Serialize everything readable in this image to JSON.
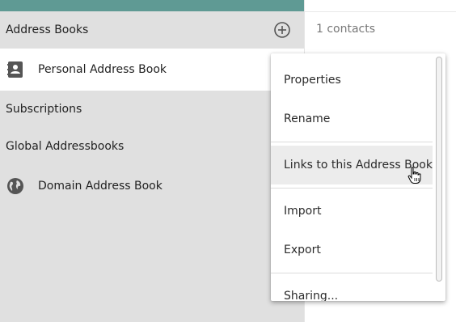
{
  "sidebar": {
    "address_books_header": "Address Books",
    "add_icon": "plus-circle-icon",
    "personal": {
      "label": "Personal Address Book",
      "icon": "contact-book-icon"
    },
    "subscriptions_header": "Subscriptions",
    "global_header": "Global Addressbooks",
    "domain": {
      "label": "Domain Address Book",
      "icon": "globe-icon"
    }
  },
  "main": {
    "contact_count": "1 contacts"
  },
  "context_menu": {
    "items": [
      {
        "label": "Properties"
      },
      {
        "label": "Rename"
      },
      {
        "label": "Links to this Address Book"
      },
      {
        "label": "Import"
      },
      {
        "label": "Export"
      },
      {
        "label": "Sharing..."
      }
    ]
  },
  "colors": {
    "topbar": "#5f9a94",
    "sidebar_bg": "#e0e0e0",
    "selected_bg": "#ffffff"
  }
}
